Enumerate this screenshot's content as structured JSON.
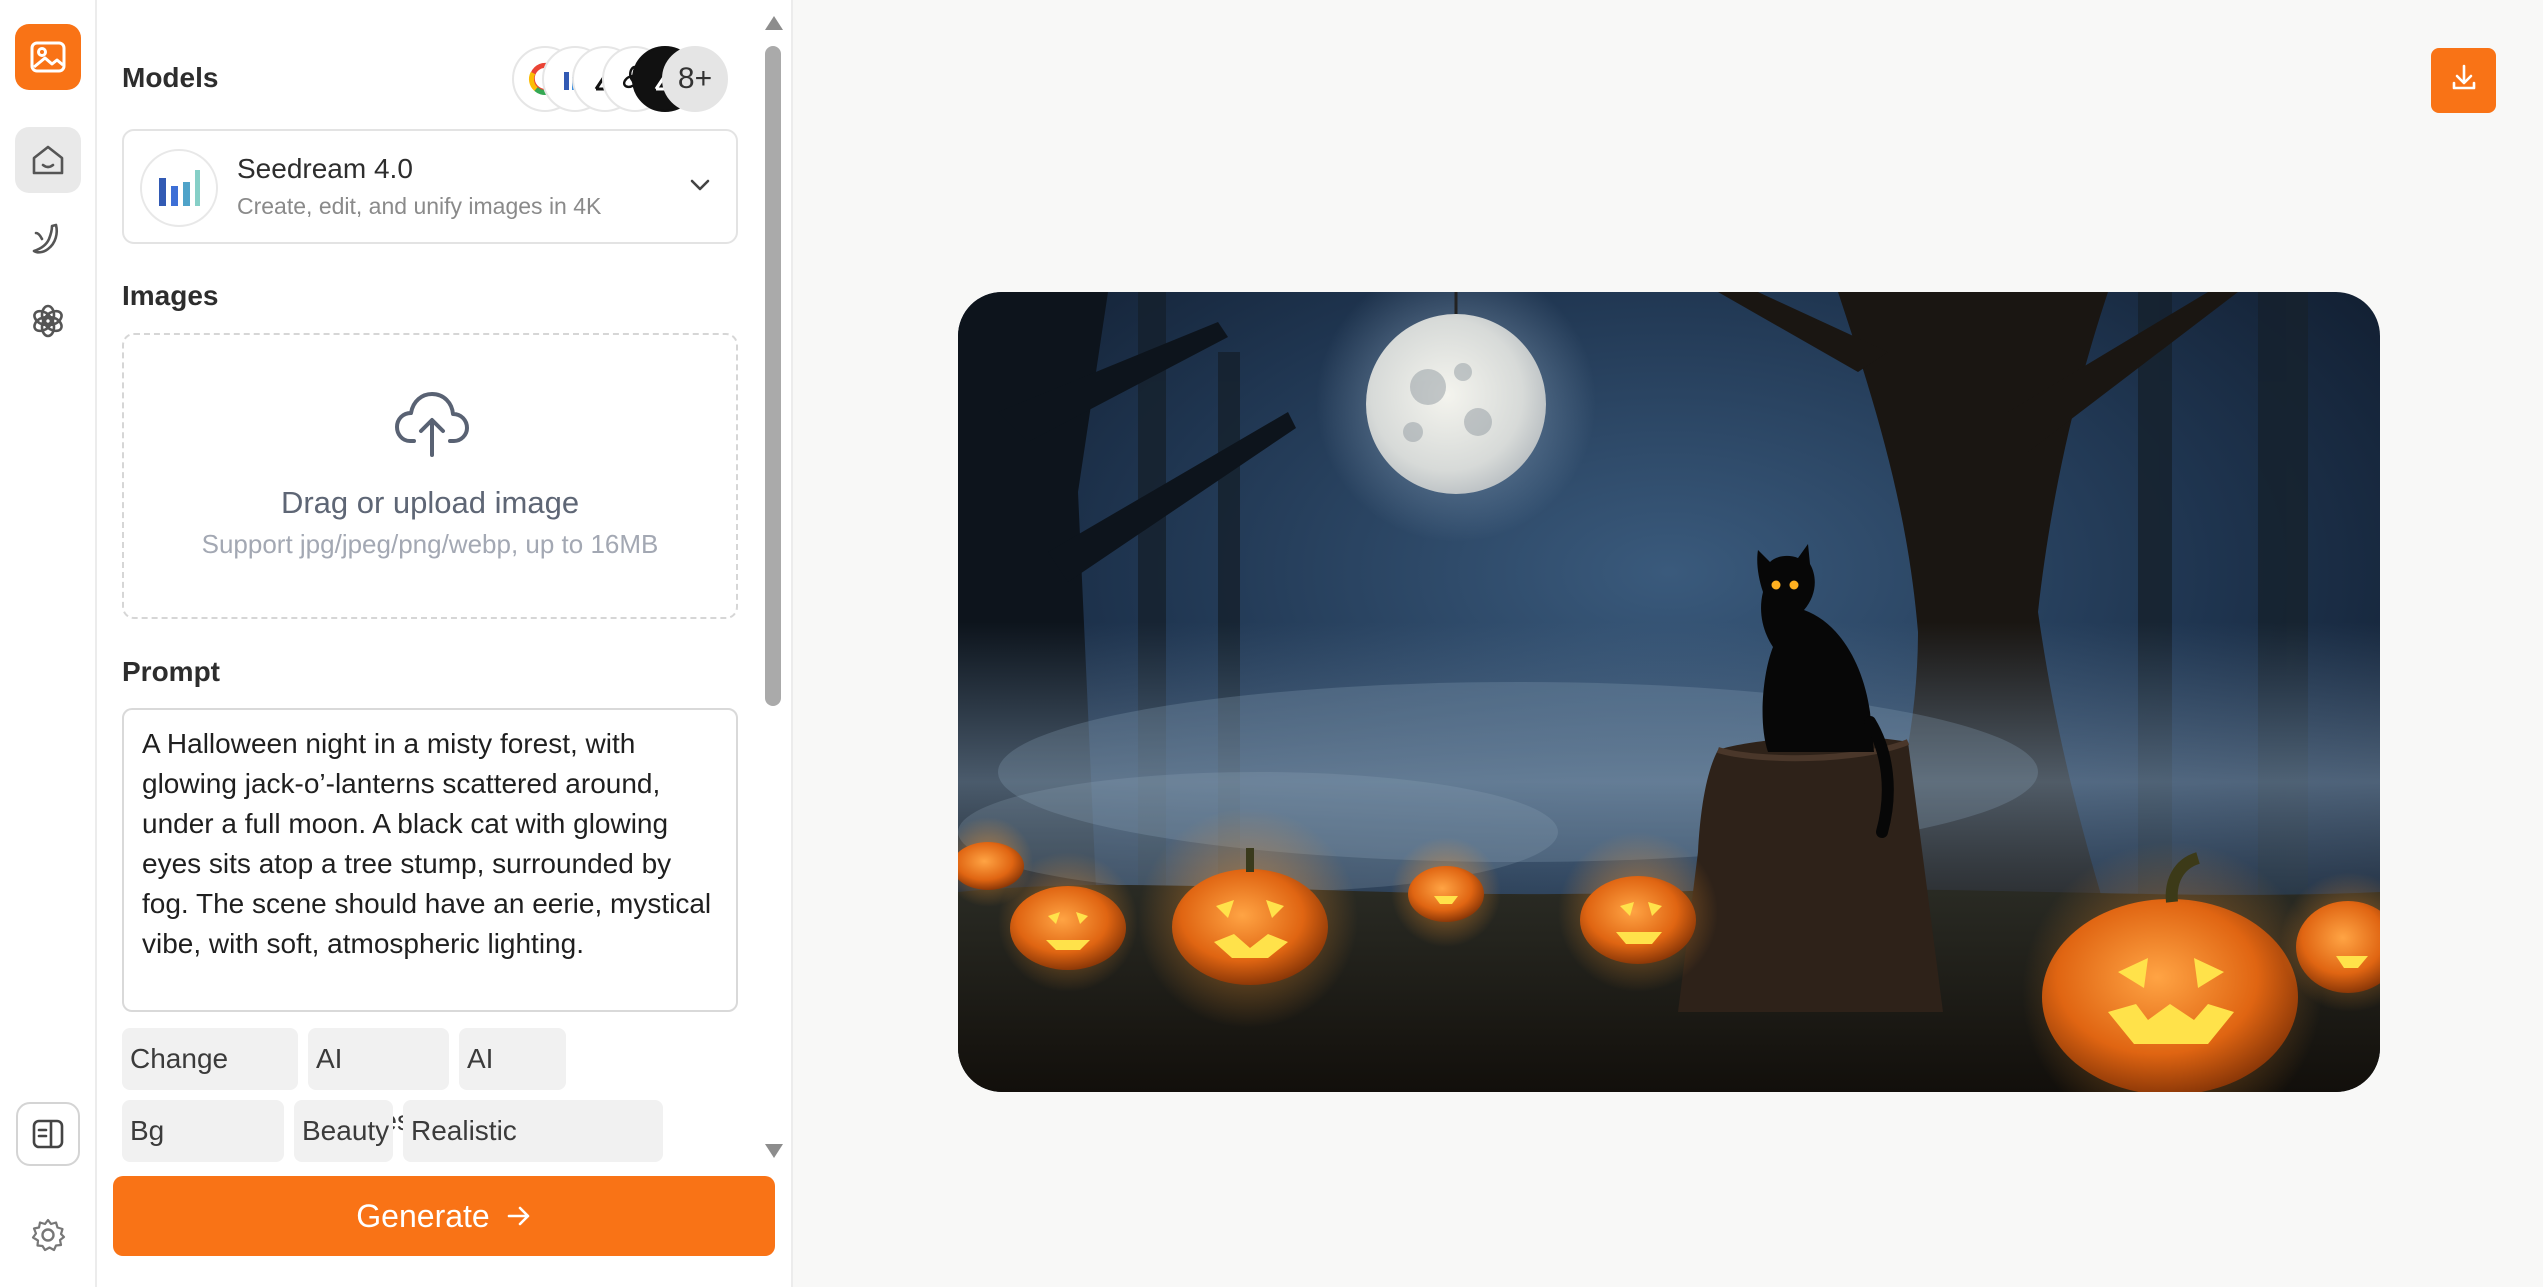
{
  "colors": {
    "accent": "#f97316",
    "accent_text": "#ffffff"
  },
  "rail": {
    "items": [
      {
        "icon": "image-generator-logo-icon"
      },
      {
        "icon": "home-icon",
        "active": true
      },
      {
        "icon": "banana-icon"
      },
      {
        "icon": "openai-icon"
      },
      {
        "icon": "panel-toggle-icon"
      },
      {
        "icon": "gear-icon"
      }
    ]
  },
  "models": {
    "title": "Models",
    "providers": [
      "google-icon",
      "bytedance-icon",
      "kling-icon",
      "openai-icon",
      "kling-dark-icon"
    ],
    "more_label": "8+",
    "selected": {
      "name": "Seedream 4.0",
      "description": "Create, edit, and unify images in 4K",
      "icon": "seedream-bars-icon"
    }
  },
  "images": {
    "title": "Images",
    "upload_title": "Drag or upload image",
    "upload_hint": "Support jpg/jpeg/png/webp, up to 16MB"
  },
  "prompt": {
    "title": "Prompt",
    "value": "A Halloween night in a misty forest, with glowing jack-o’-lanterns scattered around, under a full moon. A black cat with glowing eyes sits atop a tree stump, surrounded by fog. The scene should have an eerie, mystical vibe, with soft, atmospheric lighting."
  },
  "quick_tools": [
    "Change Pose",
    "AI Clothes",
    "AI Filter",
    "Bg Remover",
    "Beauty",
    "Realistic Conversion"
  ],
  "generate": {
    "label": "Generate",
    "icon": "arrow-right-icon"
  },
  "result": {
    "download_icon": "download-icon",
    "image": "halloween-forest-cat-image"
  }
}
